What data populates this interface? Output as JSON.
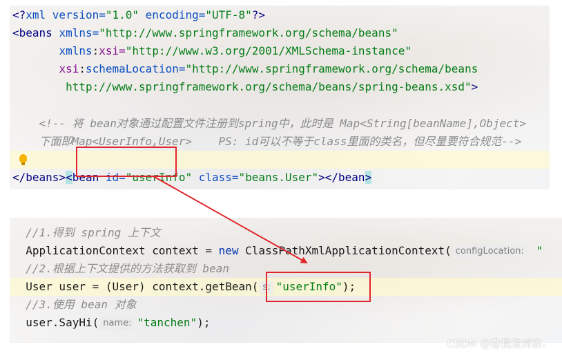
{
  "xml_snippet": {
    "line1": {
      "open": "<?",
      "name": "xml ",
      "attr1": "version=",
      "val1": "\"1.0\"",
      "attr2": " encoding=",
      "val2": "\"UTF-8\"",
      "close": "?>"
    },
    "line2": {
      "tag": "<beans ",
      "attr": "xmlns=",
      "val": "\"http://www.springframework.org/schema/beans\""
    },
    "line3": {
      "indent": "       ",
      "ns": "xmlns",
      "colon": ":",
      "attr": "xsi=",
      "val": "\"http://www.w3.org/2001/XMLSchema-instance\""
    },
    "line4": {
      "indent": "       ",
      "ns": "xsi",
      "colon": ":",
      "attr": "schemaLocation=",
      "val": "\"http://www.springframework.org/schema/beans"
    },
    "line5": {
      "indent": "        ",
      "val": "http://www.springframework.org/schema/beans/spring-beans.xsd\"",
      "close": ">"
    },
    "line6": "",
    "line7": {
      "indent": "    ",
      "text": "<!-- 将 bean对象通过配置文件注册到spring中，此时是 Map<String[beanName],Object>"
    },
    "line8": {
      "indent": "    ",
      "text": "下面即Map<UserInfo,User>    PS: id可以不等于class里面的类名，但尽量要符合规范-->"
    },
    "line9": {
      "indent": "    ",
      "lt": "<",
      "tag": "bean",
      "id_attr": " id=",
      "id_val": "\"userInfo\"",
      "class_attr": " class=",
      "class_val": "\"beans.User\"",
      "mid": "></",
      "end_tag": "bean",
      "gt": ">"
    },
    "line10": {
      "text": "</beans>"
    }
  },
  "java_snippet": {
    "line1": {
      "text": "  //1.得到 spring 上下文"
    },
    "line2": {
      "pre": "  ApplicationContext context = ",
      "kw": "new",
      "post": " ClassPathXmlApplicationContext(",
      "hint": "configLocation:",
      "str": " \""
    },
    "line3": {
      "text": "  //2.根据上下文提供的方法获取到 bean"
    },
    "line4": {
      "pre": "  User user = (User) context.getBean(",
      "hint": "s:",
      "str": "\"userInfo\"",
      "post": ");"
    },
    "line5": {
      "text": "  //3.使用 bean 对象"
    },
    "line6": {
      "pre": "  user.SayHi(",
      "hint": "name:",
      "str": "\"tanchen\"",
      "post": ");"
    }
  },
  "watermark": "CSDN @卷我没对象、",
  "colors": {
    "annotation": "#e0262a",
    "string": "#067d17",
    "keyword": "#0033b3",
    "comment": "#8c8c8c"
  }
}
